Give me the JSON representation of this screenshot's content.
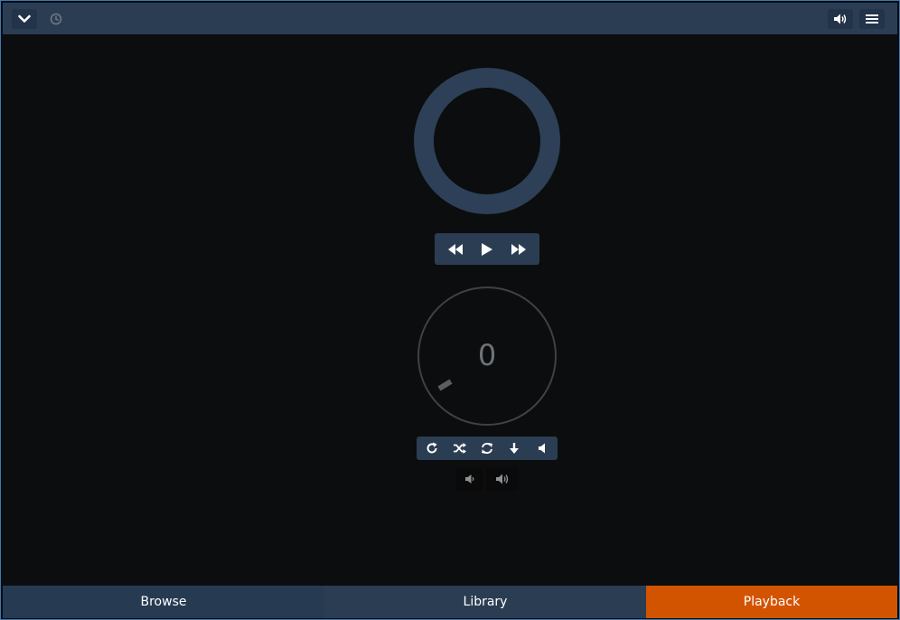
{
  "toolbar": {
    "collapse_icon": "chevron-down-icon",
    "timer_icon": "clock-icon",
    "volume_icon": "volume-up-icon",
    "menu_icon": "hamburger-menu-icon"
  },
  "player": {
    "transport": {
      "previous_icon": "rewind-icon",
      "play_icon": "play-icon",
      "next_icon": "fast-forward-icon"
    },
    "knob_value": "0",
    "options": {
      "repeat_icon": "repeat-icon",
      "shuffle_icon": "shuffle-icon",
      "consume_icon": "refresh-icon",
      "single_icon": "arrow-down-icon",
      "mute_icon": "volume-off-icon"
    },
    "volume": {
      "down_icon": "volume-down-icon",
      "up_icon": "volume-up-icon"
    }
  },
  "tabs": [
    {
      "label": "Browse",
      "color": "#263a52"
    },
    {
      "label": "Library",
      "color": "#2b3d52"
    },
    {
      "label": "Playback",
      "color": "#d35400",
      "active": true
    }
  ],
  "colors": {
    "accent": "#d35400",
    "panel": "#2b3d52",
    "background": "#0b0d0e"
  }
}
